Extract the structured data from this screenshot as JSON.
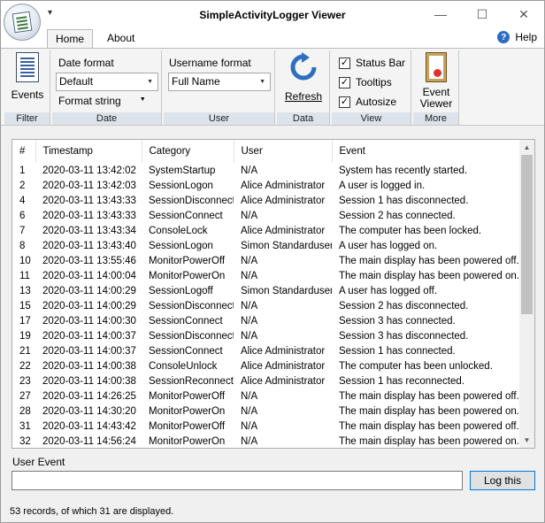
{
  "window": {
    "title": "SimpleActivityLogger Viewer",
    "qat_glyph": "▾",
    "minimize": "—",
    "maximize": "☐",
    "close": "✕"
  },
  "tabs": [
    {
      "label": "Home",
      "active": true
    },
    {
      "label": "About",
      "active": false
    }
  ],
  "help": {
    "icon": "?",
    "label": "Help"
  },
  "ribbon": {
    "filter": {
      "label": "Filter",
      "events_button": "Events",
      "icon": "events-list-icon"
    },
    "date": {
      "label": "Date",
      "format_label": "Date format",
      "format_value": "Default",
      "format_string_label": "Format string"
    },
    "user": {
      "label": "User",
      "format_label": "Username format",
      "format_value": "Full Name"
    },
    "data": {
      "label": "Data",
      "refresh_button": "Refresh",
      "icon": "refresh-icon"
    },
    "view": {
      "label": "View",
      "checkboxes": [
        {
          "label": "Status Bar",
          "checked": true
        },
        {
          "label": "Tooltips",
          "checked": true
        },
        {
          "label": "Autosize",
          "checked": true
        }
      ],
      "check_glyph": "✓"
    },
    "more": {
      "label": "More",
      "event_viewer_line1": "Event",
      "event_viewer_line2": "Viewer",
      "icon": "event-viewer-icon"
    }
  },
  "table": {
    "headers": [
      "#",
      "Timestamp",
      "Category",
      "User",
      "Event"
    ],
    "rows": [
      [
        "1",
        "2020-03-11 13:42:02",
        "SystemStartup",
        "N/A",
        "System has recently started."
      ],
      [
        "2",
        "2020-03-11 13:42:03",
        "SessionLogon",
        "Alice Administrator",
        "A user is logged in."
      ],
      [
        "4",
        "2020-03-11 13:43:33",
        "SessionDisconnect",
        "Alice Administrator",
        "Session 1 has disconnected."
      ],
      [
        "6",
        "2020-03-11 13:43:33",
        "SessionConnect",
        "N/A",
        "Session 2 has connected."
      ],
      [
        "7",
        "2020-03-11 13:43:34",
        "ConsoleLock",
        "Alice Administrator",
        "The computer has been locked."
      ],
      [
        "8",
        "2020-03-11 13:43:40",
        "SessionLogon",
        "Simon Standarduser",
        "A user has logged on."
      ],
      [
        "10",
        "2020-03-11 13:55:46",
        "MonitorPowerOff",
        "N/A",
        "The main display has been powered off."
      ],
      [
        "11",
        "2020-03-11 14:00:04",
        "MonitorPowerOn",
        "N/A",
        "The main display has been powered on."
      ],
      [
        "13",
        "2020-03-11 14:00:29",
        "SessionLogoff",
        "Simon Standarduser",
        "A user has logged off."
      ],
      [
        "15",
        "2020-03-11 14:00:29",
        "SessionDisconnect",
        "N/A",
        "Session 2 has disconnected."
      ],
      [
        "17",
        "2020-03-11 14:00:30",
        "SessionConnect",
        "N/A",
        "Session 3 has connected."
      ],
      [
        "19",
        "2020-03-11 14:00:37",
        "SessionDisconnect",
        "N/A",
        "Session 3 has disconnected."
      ],
      [
        "21",
        "2020-03-11 14:00:37",
        "SessionConnect",
        "Alice Administrator",
        "Session 1 has connected."
      ],
      [
        "22",
        "2020-03-11 14:00:38",
        "ConsoleUnlock",
        "Alice Administrator",
        "The computer has been unlocked."
      ],
      [
        "23",
        "2020-03-11 14:00:38",
        "SessionReconnect",
        "Alice Administrator",
        "Session 1 has reconnected."
      ],
      [
        "27",
        "2020-03-11 14:26:25",
        "MonitorPowerOff",
        "N/A",
        "The main display has been powered off."
      ],
      [
        "28",
        "2020-03-11 14:30:20",
        "MonitorPowerOn",
        "N/A",
        "The main display has been powered on."
      ],
      [
        "31",
        "2020-03-11 14:43:42",
        "MonitorPowerOff",
        "N/A",
        "The main display has been powered off."
      ],
      [
        "32",
        "2020-03-11 14:56:24",
        "MonitorPowerOn",
        "N/A",
        "The main display has been powered on."
      ]
    ],
    "scroll_up": "▲",
    "scroll_down": "▼"
  },
  "user_event": {
    "label": "User Event",
    "value": "",
    "button": "Log this"
  },
  "status": {
    "text": "53 records, of which 31 are displayed."
  },
  "dropdown_glyph": "▼"
}
